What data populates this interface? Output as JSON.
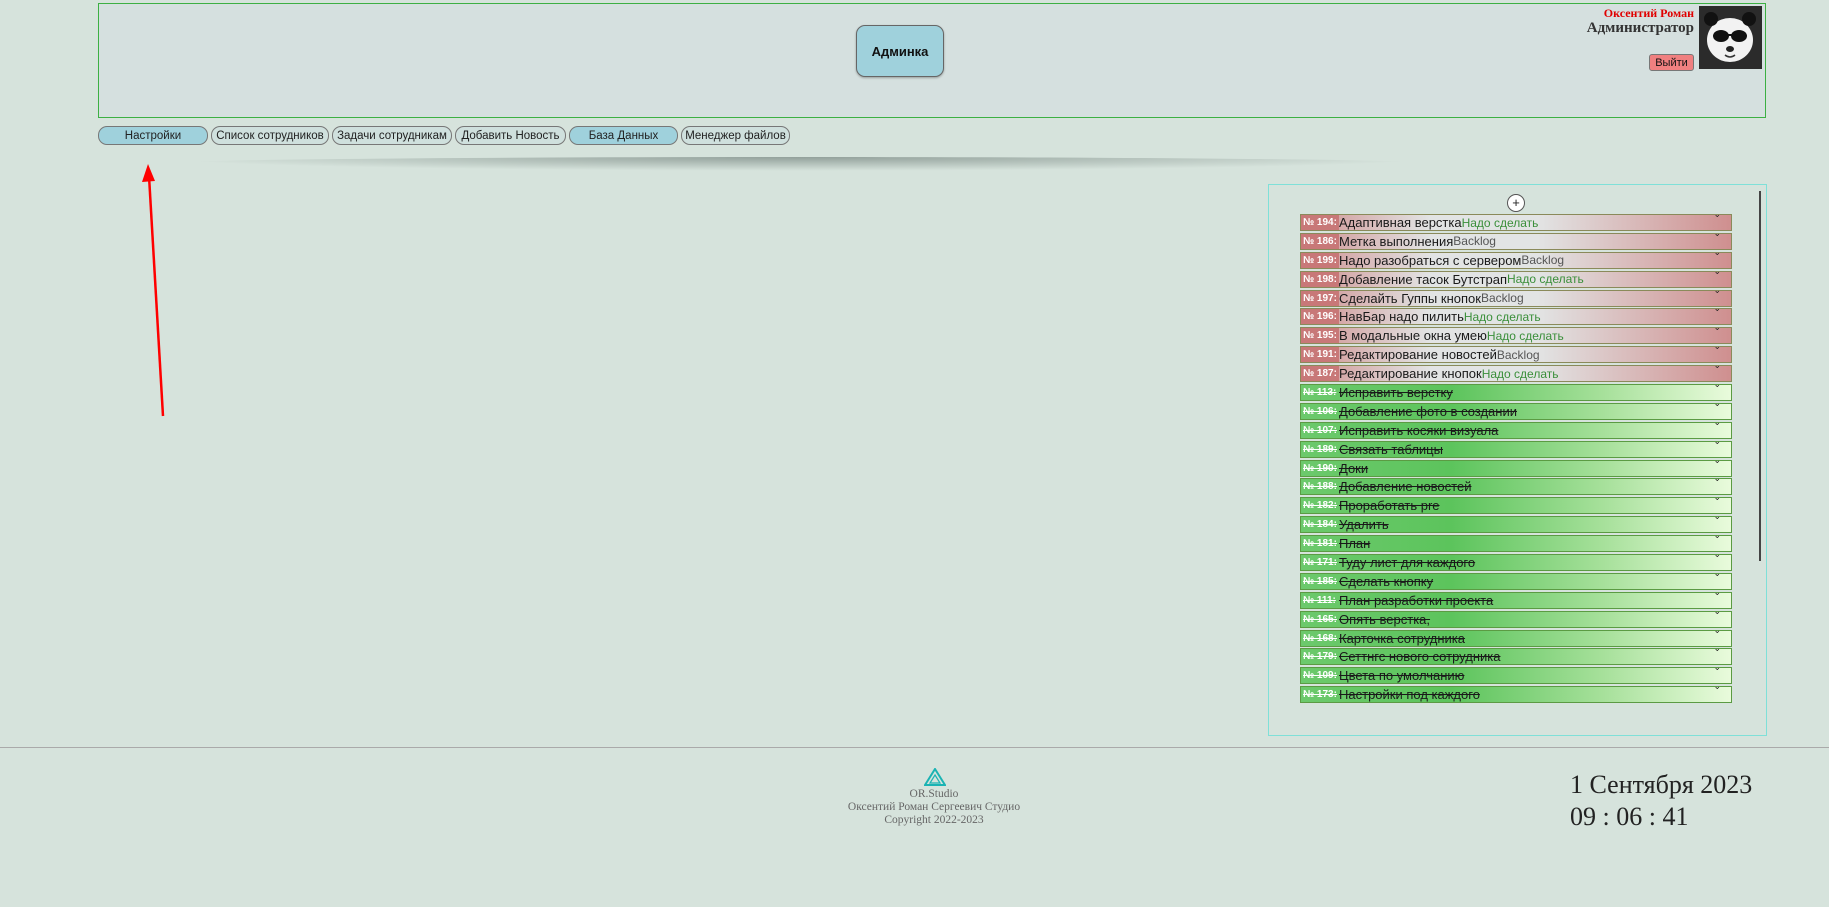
{
  "header": {
    "admin_button": "Админка",
    "user_name": "Оксентий Роман",
    "user_role": "Администратор",
    "logout": "Выйти"
  },
  "nav": [
    {
      "label": "Настройки",
      "blue": true
    },
    {
      "label": "Список сотрудников",
      "blue": false
    },
    {
      "label": "Задачи сотрудникам",
      "blue": false
    },
    {
      "label": "Добавить Новость",
      "blue": false
    },
    {
      "label": "База Данных",
      "blue": true
    },
    {
      "label": "Менеджер файлов",
      "blue": false
    }
  ],
  "tasks": {
    "add_label": "+",
    "items": [
      {
        "num": "№ 194:",
        "title": "Адаптивная верстка",
        "status": "Надо сделать",
        "done": false
      },
      {
        "num": "№ 186:",
        "title": "Метка выполнения",
        "status": "Backlog",
        "done": false
      },
      {
        "num": "№ 199:",
        "title": "Надо разобраться с сервером",
        "status": "Backlog",
        "done": false
      },
      {
        "num": "№ 198:",
        "title": "Добавление тасок Бутстрап",
        "status": "Надо сделать",
        "done": false
      },
      {
        "num": "№ 197:",
        "title": "Сделайть Гуппы кнопок",
        "status": "Backlog",
        "done": false
      },
      {
        "num": "№ 196:",
        "title": "НавБар надо пилить",
        "status": "Надо сделать",
        "done": false
      },
      {
        "num": "№ 195:",
        "title": "В модальные окна умею",
        "status": "Надо сделать",
        "done": false
      },
      {
        "num": "№ 191:",
        "title": "Редактирование новостей",
        "status": "Backlog",
        "done": false
      },
      {
        "num": "№ 187:",
        "title": "Редактирование кнопок",
        "status": "Надо сделать",
        "done": false
      },
      {
        "num": "№ 113:",
        "title": "Исправить верстку",
        "status": "",
        "done": true
      },
      {
        "num": "№ 106:",
        "title": "Добавление фото в создании",
        "status": "",
        "done": true
      },
      {
        "num": "№ 107:",
        "title": "Исправить косяки визуала",
        "status": "",
        "done": true
      },
      {
        "num": "№ 189:",
        "title": "Связать таблицы",
        "status": "",
        "done": true
      },
      {
        "num": "№ 190:",
        "title": "Доки",
        "status": "",
        "done": true
      },
      {
        "num": "№ 188:",
        "title": "Добавление новостей",
        "status": "",
        "done": true
      },
      {
        "num": "№ 182:",
        "title": "Проработать pre",
        "status": "",
        "done": true
      },
      {
        "num": "№ 184:",
        "title": "Удалить",
        "status": "",
        "done": true
      },
      {
        "num": "№ 181:",
        "title": "План",
        "status": "",
        "done": true
      },
      {
        "num": "№ 171:",
        "title": "Туду лист для каждого",
        "status": "",
        "done": true
      },
      {
        "num": "№ 185:",
        "title": "Сделать кнопку",
        "status": "",
        "done": true
      },
      {
        "num": "№ 111:",
        "title": "План разработки проекта",
        "status": "",
        "done": true
      },
      {
        "num": "№ 165:",
        "title": "Опять верстка,",
        "status": "",
        "done": true
      },
      {
        "num": "№ 168:",
        "title": "Карточка сотрудника",
        "status": "",
        "done": true
      },
      {
        "num": "№ 179:",
        "title": "Сеттнгс нового сотрудника",
        "status": "",
        "done": true
      },
      {
        "num": "№ 109:",
        "title": "Цвета по умолчанию",
        "status": "",
        "done": true
      },
      {
        "num": "№ 173:",
        "title": "Настройки под каждого",
        "status": "",
        "done": true
      }
    ]
  },
  "footer": {
    "brand": "OR.Studio",
    "company": "Оксентий Роман Сергеевич Студио",
    "copyright": "Copyright 2022-2023"
  },
  "clock": {
    "date": "1 Сентября 2023",
    "time": "09 : 06 : 41"
  },
  "colors": {
    "background": "#d6e3dc",
    "accent_blue": "#9fd1dc",
    "logout_red": "#f08080",
    "annotation_arrow": "#ff0000"
  }
}
